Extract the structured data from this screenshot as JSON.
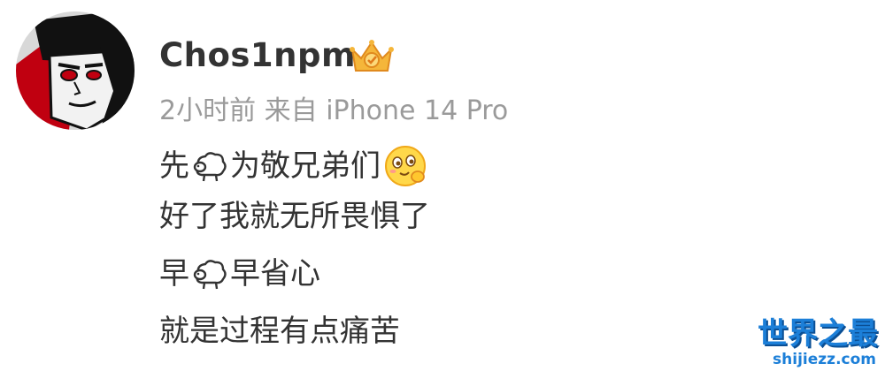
{
  "post": {
    "username": "Chos1npm",
    "badge_icon": "crown-icon",
    "time": "2小时前",
    "source_prefix": "来自",
    "source_device": "iPhone 14 Pro",
    "lines": [
      {
        "before": "先",
        "emoji": "sheep-emoji",
        "after": "为敬兄弟们",
        "emoji2": "wink-emoji"
      },
      {
        "text": "好了我就无所畏惧了"
      },
      {
        "before": "早",
        "emoji": "sheep-emoji",
        "after": "早省心"
      },
      {
        "text": "就是过程有点痛苦"
      }
    ]
  },
  "watermark": {
    "title": "世界之最",
    "url": "shijiezz.com"
  },
  "colors": {
    "username": "#333333",
    "meta": "#9a9a9a",
    "text": "#333333",
    "watermark": "#1c7fd8"
  }
}
